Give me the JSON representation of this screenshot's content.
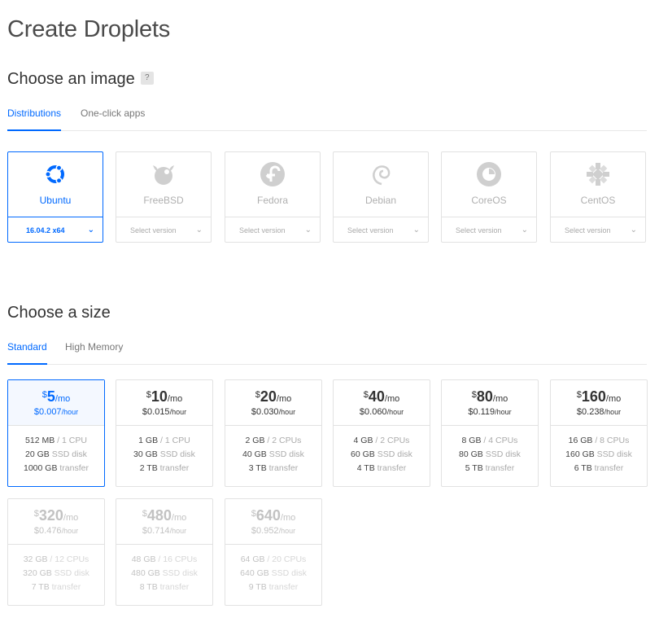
{
  "page": {
    "title": "Create Droplets"
  },
  "image_section": {
    "title": "Choose an image",
    "help": "?",
    "tabs": [
      {
        "label": "Distributions",
        "active": true
      },
      {
        "label": "One-click apps",
        "active": false
      }
    ],
    "distros": [
      {
        "name": "Ubuntu",
        "version": "16.04.2 x64",
        "selected": true,
        "icon": "ubuntu-icon"
      },
      {
        "name": "FreeBSD",
        "version": "Select version",
        "selected": false,
        "icon": "freebsd-icon"
      },
      {
        "name": "Fedora",
        "version": "Select version",
        "selected": false,
        "icon": "fedora-icon"
      },
      {
        "name": "Debian",
        "version": "Select version",
        "selected": false,
        "icon": "debian-icon"
      },
      {
        "name": "CoreOS",
        "version": "Select version",
        "selected": false,
        "icon": "coreos-icon"
      },
      {
        "name": "CentOS",
        "version": "Select version",
        "selected": false,
        "icon": "centos-icon"
      }
    ]
  },
  "size_section": {
    "title": "Choose a size",
    "tabs": [
      {
        "label": "Standard",
        "active": true
      },
      {
        "label": "High Memory",
        "active": false
      }
    ],
    "currency": "$",
    "per_month": "/mo",
    "per_hour": "/hour",
    "plans": [
      {
        "price": "5",
        "hourly": "$0.007",
        "ram": "512 MB",
        "cpu": "1 CPU",
        "disk": "20 GB",
        "disk_label": "SSD disk",
        "transfer": "1000 GB",
        "transfer_label": "transfer",
        "selected": true,
        "disabled": false
      },
      {
        "price": "10",
        "hourly": "$0.015",
        "ram": "1 GB",
        "cpu": "1 CPU",
        "disk": "30 GB",
        "disk_label": "SSD disk",
        "transfer": "2 TB",
        "transfer_label": "transfer",
        "selected": false,
        "disabled": false
      },
      {
        "price": "20",
        "hourly": "$0.030",
        "ram": "2 GB",
        "cpu": "2 CPUs",
        "disk": "40 GB",
        "disk_label": "SSD disk",
        "transfer": "3 TB",
        "transfer_label": "transfer",
        "selected": false,
        "disabled": false
      },
      {
        "price": "40",
        "hourly": "$0.060",
        "ram": "4 GB",
        "cpu": "2 CPUs",
        "disk": "60 GB",
        "disk_label": "SSD disk",
        "transfer": "4 TB",
        "transfer_label": "transfer",
        "selected": false,
        "disabled": false
      },
      {
        "price": "80",
        "hourly": "$0.119",
        "ram": "8 GB",
        "cpu": "4 CPUs",
        "disk": "80 GB",
        "disk_label": "SSD disk",
        "transfer": "5 TB",
        "transfer_label": "transfer",
        "selected": false,
        "disabled": false
      },
      {
        "price": "160",
        "hourly": "$0.238",
        "ram": "16 GB",
        "cpu": "8 CPUs",
        "disk": "160 GB",
        "disk_label": "SSD disk",
        "transfer": "6 TB",
        "transfer_label": "transfer",
        "selected": false,
        "disabled": false
      },
      {
        "price": "320",
        "hourly": "$0.476",
        "ram": "32 GB",
        "cpu": "12 CPUs",
        "disk": "320 GB",
        "disk_label": "SSD disk",
        "transfer": "7 TB",
        "transfer_label": "transfer",
        "selected": false,
        "disabled": true
      },
      {
        "price": "480",
        "hourly": "$0.714",
        "ram": "48 GB",
        "cpu": "16 CPUs",
        "disk": "480 GB",
        "disk_label": "SSD disk",
        "transfer": "8 TB",
        "transfer_label": "transfer",
        "selected": false,
        "disabled": true
      },
      {
        "price": "640",
        "hourly": "$0.952",
        "ram": "64 GB",
        "cpu": "20 CPUs",
        "disk": "640 GB",
        "disk_label": "SSD disk",
        "transfer": "9 TB",
        "transfer_label": "transfer",
        "selected": false,
        "disabled": true
      }
    ]
  },
  "colors": {
    "accent": "#0069ff",
    "muted": "#b0b0b0",
    "border": "#e2e2e2"
  }
}
